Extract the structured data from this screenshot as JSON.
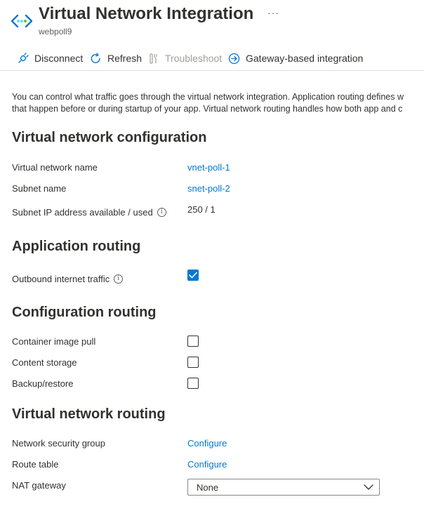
{
  "header": {
    "title": "Virtual Network Integration",
    "subtitle": "webpoll9",
    "more": "···"
  },
  "toolbar": {
    "disconnect": "Disconnect",
    "refresh": "Refresh",
    "troubleshoot": "Troubleshoot",
    "gateway": "Gateway-based integration"
  },
  "description": {
    "line1": "You can control what traffic goes through the virtual network integration. Application routing defines w",
    "line2": "that happen before or during startup of your app. Virtual network routing handles how both app and c"
  },
  "vnet_config": {
    "heading": "Virtual network configuration",
    "vnet_name_label": "Virtual network name",
    "vnet_name_value": "vnet-poll-1",
    "subnet_name_label": "Subnet name",
    "subnet_name_value": "snet-poll-2",
    "subnet_ip_label": "Subnet IP address available / used",
    "subnet_ip_value": "250 / 1"
  },
  "app_routing": {
    "heading": "Application routing",
    "outbound_label": "Outbound internet traffic",
    "outbound_checked": true
  },
  "config_routing": {
    "heading": "Configuration routing",
    "container_label": "Container image pull",
    "content_label": "Content storage",
    "backup_label": "Backup/restore"
  },
  "vnet_routing": {
    "heading": "Virtual network routing",
    "nsg_label": "Network security group",
    "nsg_link": "Configure",
    "route_label": "Route table",
    "route_link": "Configure",
    "nat_label": "NAT gateway",
    "nat_value": "None"
  },
  "colors": {
    "accent": "#0078d4",
    "text": "#323130",
    "muted": "#605e5c",
    "disabled": "#a19f9d"
  },
  "icons": {
    "logo": "vnet-integration-icon",
    "disconnect": "plug-icon",
    "refresh": "refresh-icon",
    "troubleshoot": "wrench-icon",
    "gateway": "arrow-circle-icon"
  }
}
